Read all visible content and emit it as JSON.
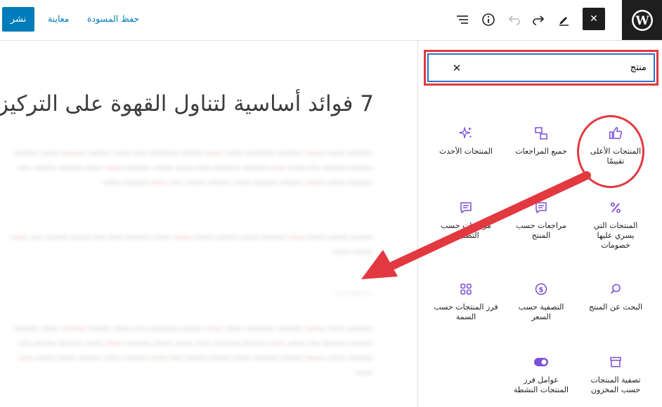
{
  "toolbar": {
    "publish_label": "نشر",
    "preview_label": "معاينة",
    "save_draft_label": "حفظ المسودة",
    "close_symbol": "✕"
  },
  "post": {
    "title": "7 فوائد أساسية لتناول القهوة على التركيز"
  },
  "search": {
    "value": "منتج"
  },
  "blocks": [
    {
      "label": "المنتجات الأعلى تقييمًا",
      "icon": "thumbs-up-icon"
    },
    {
      "label": "جميع المراجعات",
      "icon": "reviews-icon"
    },
    {
      "label": "المنتجات الأحدث",
      "icon": "sparkles-icon"
    },
    {
      "label": "المنتجات التي يسري عليها خصومات",
      "icon": "percent-icon"
    },
    {
      "label": "مراجعات حسب المنتج",
      "icon": "comment-icon"
    },
    {
      "label": "مراجعات حسب التصنيف",
      "icon": "comment-icon"
    },
    {
      "label": "البحث عن المنتج",
      "icon": "search-icon"
    },
    {
      "label": "التصفية حسب السعر",
      "icon": "price-icon"
    },
    {
      "label": "فرز المنتجات حسب السمة",
      "icon": "grid-icon"
    },
    {
      "label": "تصفية المنتجات حسب المخزون",
      "icon": "archive-icon"
    },
    {
      "label": "عوامل فرز المنتجات النشطة",
      "icon": "toggle-icon"
    }
  ],
  "colors": {
    "accent": "#007cba",
    "block_icon": "#7b4fd6",
    "annotation": "#e2383f",
    "dark": "#1e1e1e"
  }
}
